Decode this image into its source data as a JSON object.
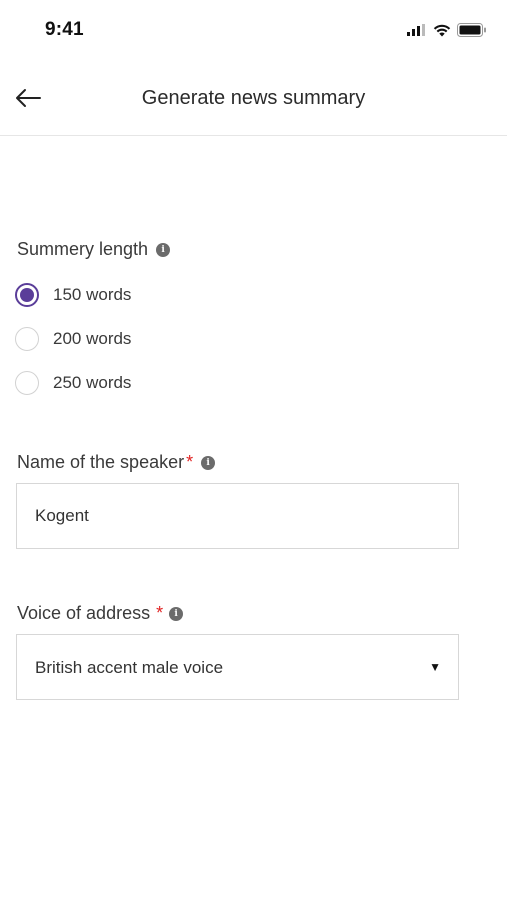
{
  "status_bar": {
    "time": "9:41",
    "icons": [
      "signal-icon",
      "wifi-icon",
      "battery-icon"
    ]
  },
  "header": {
    "back_icon": "arrow-left-icon",
    "title": "Generate news summary"
  },
  "summary_length": {
    "label": "Summery length",
    "info_icon": "info-icon",
    "options": [
      {
        "label": "150 words",
        "selected": true
      },
      {
        "label": "200 words",
        "selected": false
      },
      {
        "label": "250 words",
        "selected": false
      }
    ]
  },
  "speaker": {
    "label": "Name of the speaker",
    "required_mark": "*",
    "value": "Kogent"
  },
  "voice": {
    "label": "Voice of address",
    "required_mark": "*",
    "selected": "British accent male voice",
    "caret": "▼"
  },
  "colors": {
    "accent": "#5a3d99",
    "required": "#e02020",
    "border": "#d7d7d7"
  }
}
